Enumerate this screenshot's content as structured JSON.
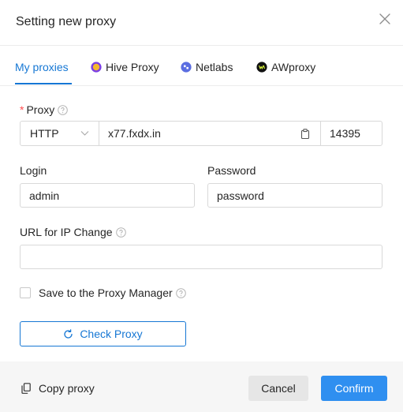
{
  "dialog": {
    "title": "Setting new proxy"
  },
  "tabs": [
    {
      "label": "My proxies",
      "icon": "",
      "active": true
    },
    {
      "label": "Hive Proxy",
      "icon": "hive-proxy-logo-icon"
    },
    {
      "label": "Netlabs",
      "icon": "netlabs-logo-icon"
    },
    {
      "label": "AWproxy",
      "icon": "awproxy-logo-icon"
    }
  ],
  "proxy": {
    "label": "Proxy",
    "required_mark": "*",
    "type": "HTTP",
    "host": "x77.fxdx.in",
    "port": "14395"
  },
  "login": {
    "label": "Login",
    "value": "admin"
  },
  "password": {
    "label": "Password",
    "value": "password"
  },
  "url_change": {
    "label": "URL for IP Change",
    "value": ""
  },
  "save_manager": {
    "label": "Save to the Proxy Manager",
    "checked": false
  },
  "check_proxy": {
    "label": "Check Proxy"
  },
  "footer": {
    "copy_label": "Copy proxy",
    "cancel_label": "Cancel",
    "confirm_label": "Confirm"
  },
  "colors": {
    "accent": "#1677d4",
    "confirm_bg": "#2f8ff0",
    "required": "#ff4d4f",
    "footer_bg": "#f6f6f6",
    "hive": "#7b3fe4",
    "hive_inner": "#f5b82e",
    "netlabs": "#5b6ee1"
  }
}
